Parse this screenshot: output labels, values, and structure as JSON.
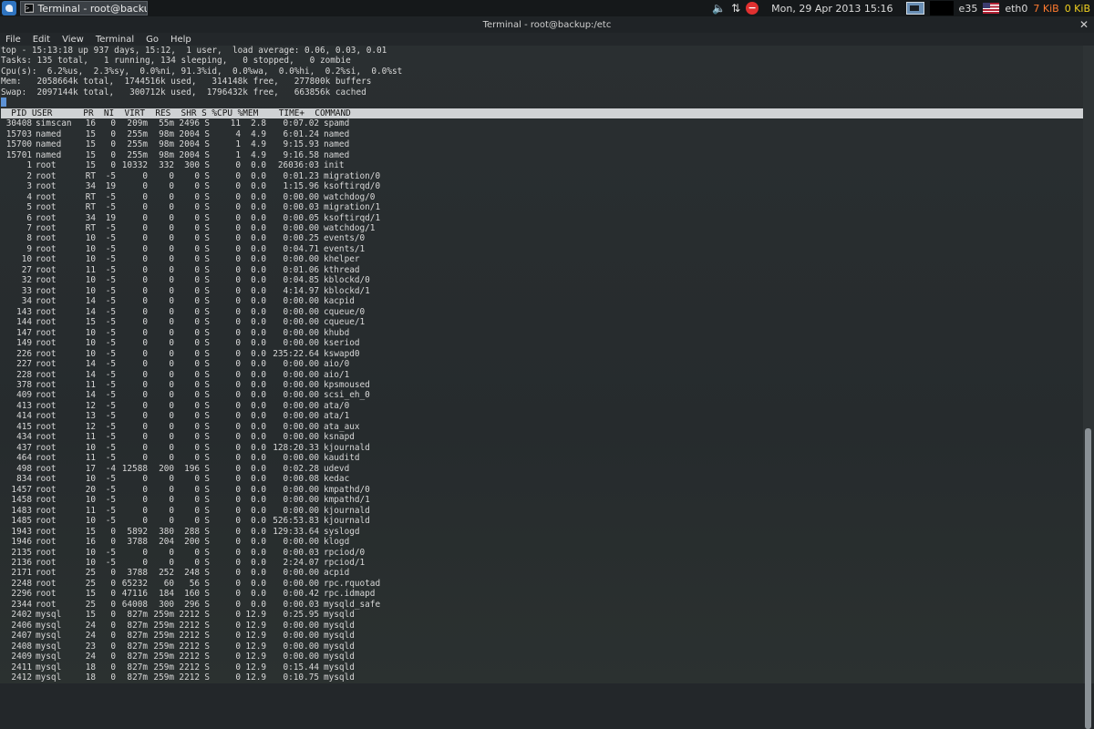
{
  "panel": {
    "task_label": "Terminal - root@backup:/etc",
    "clock": "Mon, 29 Apr 2013 15:16",
    "user": "e35",
    "iface": "eth0",
    "net_down": "7 KiB",
    "net_up": "0 KiB"
  },
  "window": {
    "title": "Terminal - root@backup:/etc",
    "menu": [
      "File",
      "Edit",
      "View",
      "Terminal",
      "Go",
      "Help"
    ]
  },
  "top": {
    "summary": [
      "top - 15:13:18 up 937 days, 15:12,  1 user,  load average: 0.06, 0.03, 0.01",
      "Tasks: 135 total,   1 running, 134 sleeping,   0 stopped,   0 zombie",
      "Cpu(s):  6.2%us,  2.3%sy,  0.0%ni, 91.3%id,  0.0%wa,  0.0%hi,  0.2%si,  0.0%st",
      "Mem:   2058664k total,  1744516k used,   314148k free,   277800k buffers",
      "Swap:  2097144k total,   300712k used,  1796432k free,   663856k cached"
    ],
    "header": "  PID USER      PR  NI  VIRT  RES  SHR S %CPU %MEM    TIME+  COMMAND",
    "processes": [
      [
        "30408",
        "simscan",
        "16",
        "0",
        "209m",
        "55m",
        "2496",
        "S",
        "11",
        "2.8",
        "0:07.02",
        "spamd"
      ],
      [
        "15703",
        "named",
        "15",
        "0",
        "255m",
        "98m",
        "2004",
        "S",
        "4",
        "4.9",
        "6:01.24",
        "named"
      ],
      [
        "15700",
        "named",
        "15",
        "0",
        "255m",
        "98m",
        "2004",
        "S",
        "1",
        "4.9",
        "9:15.93",
        "named"
      ],
      [
        "15701",
        "named",
        "15",
        "0",
        "255m",
        "98m",
        "2004",
        "S",
        "1",
        "4.9",
        "9:16.58",
        "named"
      ],
      [
        "1",
        "root",
        "15",
        "0",
        "10332",
        "332",
        "300",
        "S",
        "0",
        "0.0",
        "26036:03",
        "init"
      ],
      [
        "2",
        "root",
        "RT",
        "-5",
        "0",
        "0",
        "0",
        "S",
        "0",
        "0.0",
        "0:01.23",
        "migration/0"
      ],
      [
        "3",
        "root",
        "34",
        "19",
        "0",
        "0",
        "0",
        "S",
        "0",
        "0.0",
        "1:15.96",
        "ksoftirqd/0"
      ],
      [
        "4",
        "root",
        "RT",
        "-5",
        "0",
        "0",
        "0",
        "S",
        "0",
        "0.0",
        "0:00.00",
        "watchdog/0"
      ],
      [
        "5",
        "root",
        "RT",
        "-5",
        "0",
        "0",
        "0",
        "S",
        "0",
        "0.0",
        "0:00.03",
        "migration/1"
      ],
      [
        "6",
        "root",
        "34",
        "19",
        "0",
        "0",
        "0",
        "S",
        "0",
        "0.0",
        "0:00.05",
        "ksoftirqd/1"
      ],
      [
        "7",
        "root",
        "RT",
        "-5",
        "0",
        "0",
        "0",
        "S",
        "0",
        "0.0",
        "0:00.00",
        "watchdog/1"
      ],
      [
        "8",
        "root",
        "10",
        "-5",
        "0",
        "0",
        "0",
        "S",
        "0",
        "0.0",
        "0:00.25",
        "events/0"
      ],
      [
        "9",
        "root",
        "10",
        "-5",
        "0",
        "0",
        "0",
        "S",
        "0",
        "0.0",
        "0:04.71",
        "events/1"
      ],
      [
        "10",
        "root",
        "10",
        "-5",
        "0",
        "0",
        "0",
        "S",
        "0",
        "0.0",
        "0:00.00",
        "khelper"
      ],
      [
        "27",
        "root",
        "11",
        "-5",
        "0",
        "0",
        "0",
        "S",
        "0",
        "0.0",
        "0:01.06",
        "kthread"
      ],
      [
        "32",
        "root",
        "10",
        "-5",
        "0",
        "0",
        "0",
        "S",
        "0",
        "0.0",
        "0:04.85",
        "kblockd/0"
      ],
      [
        "33",
        "root",
        "10",
        "-5",
        "0",
        "0",
        "0",
        "S",
        "0",
        "0.0",
        "4:14.97",
        "kblockd/1"
      ],
      [
        "34",
        "root",
        "14",
        "-5",
        "0",
        "0",
        "0",
        "S",
        "0",
        "0.0",
        "0:00.00",
        "kacpid"
      ],
      [
        "143",
        "root",
        "14",
        "-5",
        "0",
        "0",
        "0",
        "S",
        "0",
        "0.0",
        "0:00.00",
        "cqueue/0"
      ],
      [
        "144",
        "root",
        "15",
        "-5",
        "0",
        "0",
        "0",
        "S",
        "0",
        "0.0",
        "0:00.00",
        "cqueue/1"
      ],
      [
        "147",
        "root",
        "10",
        "-5",
        "0",
        "0",
        "0",
        "S",
        "0",
        "0.0",
        "0:00.00",
        "khubd"
      ],
      [
        "149",
        "root",
        "10",
        "-5",
        "0",
        "0",
        "0",
        "S",
        "0",
        "0.0",
        "0:00.00",
        "kseriod"
      ],
      [
        "226",
        "root",
        "10",
        "-5",
        "0",
        "0",
        "0",
        "S",
        "0",
        "0.0",
        "235:22.64",
        "kswapd0"
      ],
      [
        "227",
        "root",
        "14",
        "-5",
        "0",
        "0",
        "0",
        "S",
        "0",
        "0.0",
        "0:00.00",
        "aio/0"
      ],
      [
        "228",
        "root",
        "14",
        "-5",
        "0",
        "0",
        "0",
        "S",
        "0",
        "0.0",
        "0:00.00",
        "aio/1"
      ],
      [
        "378",
        "root",
        "11",
        "-5",
        "0",
        "0",
        "0",
        "S",
        "0",
        "0.0",
        "0:00.00",
        "kpsmoused"
      ],
      [
        "409",
        "root",
        "14",
        "-5",
        "0",
        "0",
        "0",
        "S",
        "0",
        "0.0",
        "0:00.00",
        "scsi_eh_0"
      ],
      [
        "413",
        "root",
        "12",
        "-5",
        "0",
        "0",
        "0",
        "S",
        "0",
        "0.0",
        "0:00.00",
        "ata/0"
      ],
      [
        "414",
        "root",
        "13",
        "-5",
        "0",
        "0",
        "0",
        "S",
        "0",
        "0.0",
        "0:00.00",
        "ata/1"
      ],
      [
        "415",
        "root",
        "12",
        "-5",
        "0",
        "0",
        "0",
        "S",
        "0",
        "0.0",
        "0:00.00",
        "ata_aux"
      ],
      [
        "434",
        "root",
        "11",
        "-5",
        "0",
        "0",
        "0",
        "S",
        "0",
        "0.0",
        "0:00.00",
        "ksnapd"
      ],
      [
        "437",
        "root",
        "10",
        "-5",
        "0",
        "0",
        "0",
        "S",
        "0",
        "0.0",
        "128:20.33",
        "kjournald"
      ],
      [
        "464",
        "root",
        "11",
        "-5",
        "0",
        "0",
        "0",
        "S",
        "0",
        "0.0",
        "0:00.00",
        "kauditd"
      ],
      [
        "498",
        "root",
        "17",
        "-4",
        "12588",
        "200",
        "196",
        "S",
        "0",
        "0.0",
        "0:02.28",
        "udevd"
      ],
      [
        "834",
        "root",
        "10",
        "-5",
        "0",
        "0",
        "0",
        "S",
        "0",
        "0.0",
        "0:00.08",
        "kedac"
      ],
      [
        "1457",
        "root",
        "20",
        "-5",
        "0",
        "0",
        "0",
        "S",
        "0",
        "0.0",
        "0:00.00",
        "kmpathd/0"
      ],
      [
        "1458",
        "root",
        "10",
        "-5",
        "0",
        "0",
        "0",
        "S",
        "0",
        "0.0",
        "0:00.00",
        "kmpathd/1"
      ],
      [
        "1483",
        "root",
        "11",
        "-5",
        "0",
        "0",
        "0",
        "S",
        "0",
        "0.0",
        "0:00.00",
        "kjournald"
      ],
      [
        "1485",
        "root",
        "10",
        "-5",
        "0",
        "0",
        "0",
        "S",
        "0",
        "0.0",
        "526:53.83",
        "kjournald"
      ],
      [
        "1943",
        "root",
        "15",
        "0",
        "5892",
        "380",
        "288",
        "S",
        "0",
        "0.0",
        "129:33.64",
        "syslogd"
      ],
      [
        "1946",
        "root",
        "16",
        "0",
        "3788",
        "204",
        "200",
        "S",
        "0",
        "0.0",
        "0:00.00",
        "klogd"
      ],
      [
        "2135",
        "root",
        "10",
        "-5",
        "0",
        "0",
        "0",
        "S",
        "0",
        "0.0",
        "0:00.03",
        "rpciod/0"
      ],
      [
        "2136",
        "root",
        "10",
        "-5",
        "0",
        "0",
        "0",
        "S",
        "0",
        "0.0",
        "2:24.07",
        "rpciod/1"
      ],
      [
        "2171",
        "root",
        "25",
        "0",
        "3788",
        "252",
        "248",
        "S",
        "0",
        "0.0",
        "0:00.00",
        "acpid"
      ],
      [
        "2248",
        "root",
        "25",
        "0",
        "65232",
        "60",
        "56",
        "S",
        "0",
        "0.0",
        "0:00.00",
        "rpc.rquotad"
      ],
      [
        "2296",
        "root",
        "15",
        "0",
        "47116",
        "184",
        "160",
        "S",
        "0",
        "0.0",
        "0:00.42",
        "rpc.idmapd"
      ],
      [
        "2344",
        "root",
        "25",
        "0",
        "64008",
        "300",
        "296",
        "S",
        "0",
        "0.0",
        "0:00.03",
        "mysqld_safe"
      ],
      [
        "2402",
        "mysql",
        "15",
        "0",
        "827m",
        "259m",
        "2212",
        "S",
        "0",
        "12.9",
        "0:25.95",
        "mysqld"
      ],
      [
        "2406",
        "mysql",
        "24",
        "0",
        "827m",
        "259m",
        "2212",
        "S",
        "0",
        "12.9",
        "0:00.00",
        "mysqld"
      ],
      [
        "2407",
        "mysql",
        "24",
        "0",
        "827m",
        "259m",
        "2212",
        "S",
        "0",
        "12.9",
        "0:00.00",
        "mysqld"
      ],
      [
        "2408",
        "mysql",
        "23",
        "0",
        "827m",
        "259m",
        "2212",
        "S",
        "0",
        "12.9",
        "0:00.00",
        "mysqld"
      ],
      [
        "2409",
        "mysql",
        "24",
        "0",
        "827m",
        "259m",
        "2212",
        "S",
        "0",
        "12.9",
        "0:00.00",
        "mysqld"
      ],
      [
        "2411",
        "mysql",
        "18",
        "0",
        "827m",
        "259m",
        "2212",
        "S",
        "0",
        "12.9",
        "0:15.44",
        "mysqld"
      ],
      [
        "2412",
        "mysql",
        "18",
        "0",
        "827m",
        "259m",
        "2212",
        "S",
        "0",
        "12.9",
        "0:10.75",
        "mysqld"
      ]
    ]
  },
  "colors": {
    "panel_bg": "#15181a",
    "terminal_bg": "#2a2f31",
    "terminal_fg": "#d8d8d8",
    "header_bg": "#cfd2d4",
    "cursor": "#5d92d6",
    "mute_red": "#e03030"
  }
}
